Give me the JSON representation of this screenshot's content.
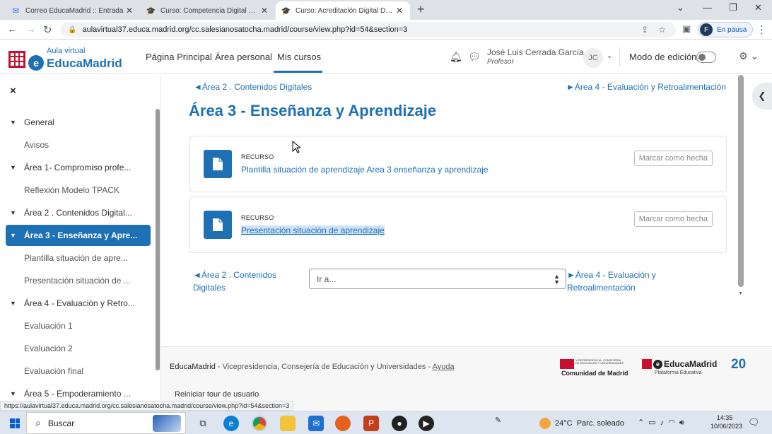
{
  "browser": {
    "tabs": [
      {
        "title": "Correo EducaMadrid :: Entrada",
        "icon": "mail-icon"
      },
      {
        "title": "Curso: Competencia Digital Doce",
        "icon": "graduation-cap-icon"
      },
      {
        "title": "Curso: Acreditación Digital Doce",
        "icon": "graduation-cap-icon",
        "active": true
      }
    ],
    "url": "aulavirtual37.educa.madrid.org/cc.salesianosatocha.madrid/course/view.php?id=54&section=3",
    "profile_initial": "F",
    "profile_status": "En pausa"
  },
  "navbar": {
    "logo_top": "Aula virtual",
    "logo_main": "EducaMadrid",
    "links": [
      "Página Principal",
      "Área personal",
      "Mis cursos"
    ],
    "active_link": "Mis cursos",
    "user_name": "José Luis Cerrada García",
    "user_role": "Profesor",
    "user_initials": "JC",
    "edit_mode_label": "Modo de edición",
    "edit_mode_on": false
  },
  "drawer": {
    "close_glyph": "×",
    "items": [
      {
        "label": "General",
        "type": "section"
      },
      {
        "label": "Avisos",
        "type": "sub"
      },
      {
        "label": "Área 1- Compromiso profe...",
        "type": "section"
      },
      {
        "label": "Reflexión Modelo TPACK",
        "type": "sub"
      },
      {
        "label": "Área 2 . Contenidos Digital...",
        "type": "section"
      },
      {
        "label": "Área 3 - Enseñanza y Apre...",
        "type": "section",
        "active": true
      },
      {
        "label": "Plantilla situación de apre...",
        "type": "sub"
      },
      {
        "label": "Presentación situación de ...",
        "type": "sub"
      },
      {
        "label": "Área 4 - Evaluación y Retro...",
        "type": "section"
      },
      {
        "label": "Evaluación 1",
        "type": "sub"
      },
      {
        "label": "Evaluación 2",
        "type": "sub"
      },
      {
        "label": "Evaluación final",
        "type": "sub"
      },
      {
        "label": "Área 5 - Empoderamiento ...",
        "type": "section"
      }
    ]
  },
  "main": {
    "prev_section_top": "◄Área 2 . Contenidos Digitales",
    "next_section_top": "►Área 4 - Evaluación y Retroalimentación",
    "title": "Área 3 - Enseñanza y Aprendizaje",
    "activities": [
      {
        "kind": "RECURSO",
        "name": "Plantilla situación de aprendizaje Area 3 enseñanza y aprendizaje",
        "button": "Marcar como hecha"
      },
      {
        "kind": "RECURSO",
        "name": "Presentación situación de aprendizaje",
        "button": "Marcar como hecha",
        "selected": true
      }
    ],
    "prev_bottom_line1": "◄Área 2 . Contenidos",
    "prev_bottom_line2": "Digitales",
    "jump_placeholder": "Ir a...",
    "next_bottom_line1": "►Área 4 - Evaluación y",
    "next_bottom_line2": "Retroalimentación"
  },
  "footer": {
    "brand": "EducaMadrid",
    "text": " - Vicepresidencia, Consejería de Educación y Universidades - ",
    "help": "Ayuda",
    "tour": "Reiniciar tour de usuario",
    "cm_small": "VICEPRESIDENCIA, CONSEJERÍA DE EDUCACIÓN Y UNIVERSIDADES",
    "cm_name": "Comunidad de Madrid",
    "em_name": "EducaMadrid",
    "em_sub": "Plataforma Educativa",
    "badge": "20"
  },
  "status_url": "https://aulavirtual37.educa.madrid.org/cc.salesianosatocha.madrid/course/view.php?id=54&section=3",
  "taskbar": {
    "search_label": "Buscar",
    "temperature": "24°C",
    "weather": "Parc. soleado",
    "time": "14:35",
    "date": "10/06/2023"
  }
}
